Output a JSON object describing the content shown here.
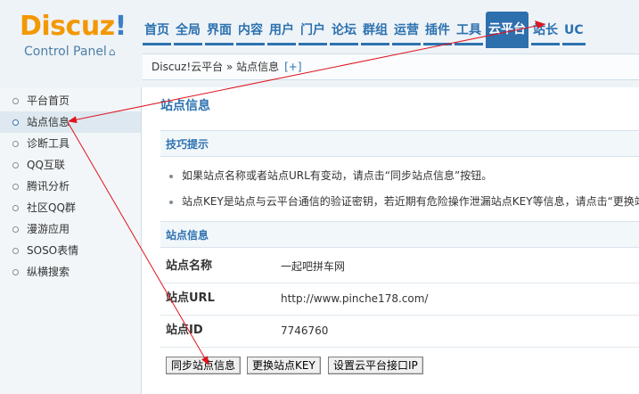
{
  "header": {
    "logo": "Discuz",
    "logo_bang": "!",
    "logo_sub": "Control Panel",
    "nav": [
      "首页",
      "全局",
      "界面",
      "内容",
      "用户",
      "门户",
      "论坛",
      "群组",
      "运营",
      "插件",
      "工具",
      "云平台",
      "站长",
      "UC"
    ],
    "active_nav": "云平台",
    "breadcrumb": "Discuz!云平台 » 站点信息",
    "breadcrumb_add": "[+]"
  },
  "sidebar": {
    "items": [
      "平台首页",
      "站点信息",
      "诊断工具",
      "QQ互联",
      "腾讯分析",
      "社区QQ群",
      "漫游应用",
      "SOSO表情",
      "纵横搜索"
    ],
    "active": "站点信息"
  },
  "main": {
    "title": "站点信息",
    "tips_title": "技巧提示",
    "tips": [
      "如果站点名称或者站点URL有变动，请点击“同步站点信息”按钮。",
      "站点KEY是站点与云平台通信的验证密钥，若近期有危险操作泄漏站点KEY等信息，请点击“更换站"
    ],
    "info_title": "站点信息",
    "info": [
      {
        "key": "站点名称",
        "value": "一起吧拼车网"
      },
      {
        "key": "站点URL",
        "value": "http://www.pinche178.com/"
      },
      {
        "key": "站点ID",
        "value": "7746760"
      }
    ],
    "buttons": {
      "sync": "同步站点信息",
      "change_key": "更换站点KEY",
      "set_api_ip": "设置云平台接口IP"
    }
  },
  "colors": {
    "accent": "#2d72b0",
    "logo_orange": "#f39800",
    "annotation_red": "#e0141e"
  }
}
